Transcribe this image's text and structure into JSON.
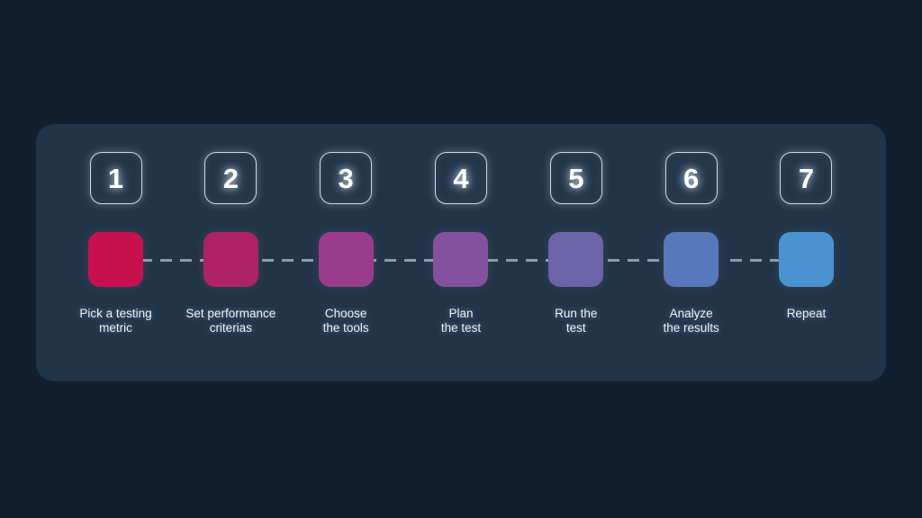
{
  "theme": {
    "page_background": "#121f2e",
    "card_background": "#223448",
    "connector_color": "#8c9bad",
    "label_color": "#eaf0f6",
    "number_border_color": "#cdd8e3",
    "number_color": "#ffffff"
  },
  "diagram": {
    "type": "process-flow",
    "orientation": "horizontal",
    "step_count": 7,
    "steps": [
      {
        "number": "1",
        "label": "Pick a testing\nmetric",
        "color": "#c8104f"
      },
      {
        "number": "2",
        "label": "Set performance\ncriterias",
        "color": "#ad2269"
      },
      {
        "number": "3",
        "label": "Choose\nthe tools",
        "color": "#9b3b8c"
      },
      {
        "number": "4",
        "label": "Plan\nthe test",
        "color": "#84519f"
      },
      {
        "number": "5",
        "label": "Run the\ntest",
        "color": "#6d63a8"
      },
      {
        "number": "6",
        "label": "Analyze\nthe results",
        "color": "#5878bd"
      },
      {
        "number": "7",
        "label": "Repeat",
        "color": "#4a93d1"
      }
    ]
  }
}
